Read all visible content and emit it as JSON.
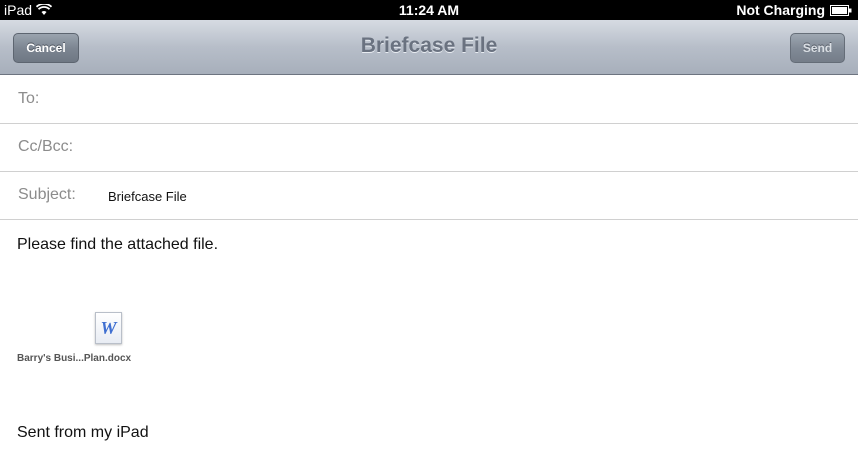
{
  "status_bar": {
    "device": "iPad",
    "time": "11:24 AM",
    "charging": "Not Charging"
  },
  "nav": {
    "title": "Briefcase File",
    "cancel_label": "Cancel",
    "send_label": "Send"
  },
  "fields": {
    "to_label": "To:",
    "to_value": "",
    "ccbcc_label": "Cc/Bcc:",
    "ccbcc_value": "",
    "subject_label": "Subject:",
    "subject_value": "Briefcase File"
  },
  "body": {
    "message": "Please find the attached file.",
    "attachment": {
      "icon_glyph": "W",
      "icon_name": "word-document-icon",
      "filename": "Barry's Busi...Plan.docx"
    },
    "signature": "Sent from my iPad"
  },
  "colors": {
    "status_bar": "#000000",
    "nav_title": "#6a7280",
    "attachment_icon": "#3f6fd1"
  }
}
